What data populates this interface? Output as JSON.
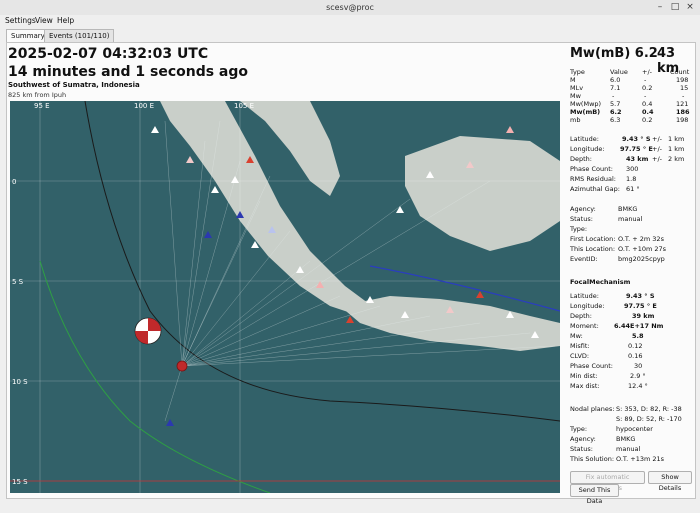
{
  "window": {
    "title": "scesv@proc"
  },
  "menu": [
    "Settings",
    "View",
    "Help"
  ],
  "tabs": [
    "Summary",
    "Events (101/110)"
  ],
  "event": {
    "origin_time": "2025-02-07 04:32:03 UTC",
    "elapsed": "14 minutes and 1 seconds ago",
    "region": "Southwest of Sumatra, Indonesia",
    "nearest": "825 km from Ipuh",
    "magnitude_label": "Mw(mB)  6.2",
    "depth_label": "43 km"
  },
  "map": {
    "lat_labels": [
      "0",
      "5 S",
      "10 S",
      "15 S"
    ],
    "lon_labels": [
      "95 E",
      "100 E",
      "105 E"
    ],
    "colors": {
      "ocean": "#2f5e66",
      "land": "#c9cfc9",
      "event": "#c0292b"
    }
  },
  "magnitudes": {
    "headers": [
      "Type",
      "Value",
      "+/-",
      "Count"
    ],
    "rows": [
      [
        "M",
        "6.0",
        "-",
        "198"
      ],
      [
        "MLv",
        "7.1",
        "0.2",
        "15"
      ],
      [
        "Mw",
        "-",
        "-",
        "-"
      ],
      [
        "Mw(Mwp)",
        "5.7",
        "0.4",
        "121"
      ],
      [
        "Mw(mB)",
        "6.2",
        "0.4",
        "186"
      ],
      [
        "mb",
        "6.3",
        "0.2",
        "198"
      ]
    ]
  },
  "location": {
    "latitude": [
      "Latitude:",
      "9.43 ° S",
      "+/-",
      "1 km"
    ],
    "longitude": [
      "Longitude:",
      "97.75 ° E",
      "+/-",
      "1 km"
    ],
    "depth": [
      "Depth:",
      "43 km",
      "+/-",
      "2 km"
    ],
    "phase_count": [
      "Phase Count:",
      "300"
    ],
    "rms": [
      "RMS Residual:",
      "1.8"
    ],
    "gap": [
      "Azimuthal Gap:",
      "61 °"
    ],
    "agency": [
      "Agency:",
      "BMKG"
    ],
    "status": [
      "Status:",
      "manual"
    ],
    "type": [
      "Type:",
      ""
    ],
    "first_location": [
      "First Location:",
      "O.T. + 2m 32s"
    ],
    "this_location": [
      "This Location:",
      "O.T. +10m 27s"
    ],
    "event_id": [
      "EventID:",
      "bmg2025cpyp"
    ]
  },
  "focal": {
    "title": "FocalMechanism",
    "rows": [
      [
        "Latitude:",
        "9.43 ° S"
      ],
      [
        "Longitude:",
        "97.75 ° E"
      ],
      [
        "Depth:",
        "39 km"
      ],
      [
        "Moment:",
        "6.44E+17 Nm"
      ],
      [
        "Mw:",
        "5.8"
      ],
      [
        "Misfit:",
        "0.12"
      ],
      [
        "CLVD:",
        "0.16"
      ],
      [
        "Phase Count:",
        "30"
      ],
      [
        "Min dist:",
        "2.9 °"
      ],
      [
        "Max dist:",
        "12.4 °"
      ]
    ],
    "nodal_label": "Nodal planes:",
    "nodal1": "S: 353, D: 82, R: -38",
    "nodal2": "S: 89, D: 52, R: -170",
    "type": [
      "Type:",
      "hypocenter"
    ],
    "agency": [
      "Agency:",
      "BMKG"
    ],
    "status": [
      "Status:",
      "manual"
    ],
    "this_solution": [
      "This Solution:",
      "O.T. +13m 21s"
    ]
  },
  "buttons": {
    "fix": "Fix automatic solutions",
    "details": "Show Details",
    "send": "Send This Data"
  }
}
